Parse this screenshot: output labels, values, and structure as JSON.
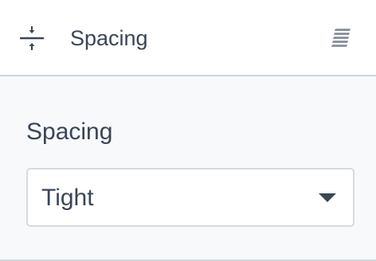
{
  "header": {
    "icon": "spacing-icon",
    "title": "Spacing",
    "block_icon": "paragraph-lines-icon"
  },
  "spacing_field": {
    "label": "Spacing",
    "selected_value": "Tight",
    "dropdown_icon": "chevron-down-icon"
  },
  "colors": {
    "text": "#3a4556",
    "panel_background": "#f7f9fb",
    "border": "#d6dadf",
    "icon_gray": "#8e959e"
  }
}
